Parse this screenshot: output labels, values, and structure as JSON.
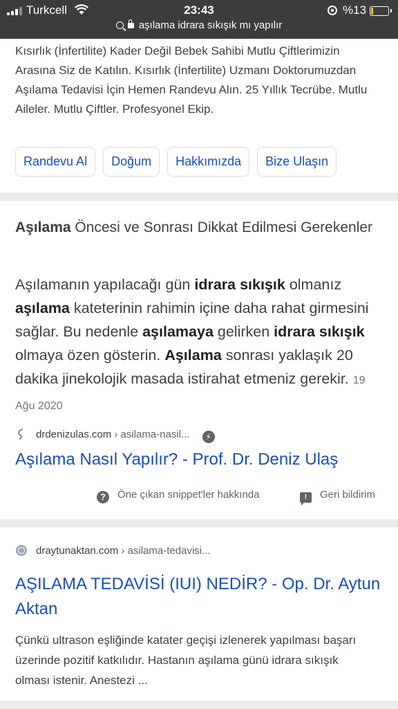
{
  "status_bar": {
    "carrier": "Turkcell",
    "time": "23:43",
    "battery_percent": "%13",
    "battery_level": 0.13,
    "url": "aşılama idrara sıkışık mı yapılır",
    "icons": [
      "signal-icon",
      "wifi-icon",
      "rotation-lock-icon",
      "battery-icon",
      "search-icon",
      "lock-icon"
    ]
  },
  "ad": {
    "text": "Kısırlık (İnfertilite) Kader Değil Bebek Sahibi Mutlu Çiftlerimizin Arasına Siz de Katılın. Kısırlık (İnfertilite) Uzmanı Doktorumuzdan Aşılama Tedavisi İçin Hemen Randevu Alın. 25 Yıllık Tecrübe. Mutlu Aileler. Mutlu Çiftler. Profesyonel Ekip.",
    "sitelinks": [
      "Randevu Al",
      "Doğum",
      "Hakkımızda",
      "Bize Ulaşın"
    ]
  },
  "featured_snippet": {
    "title_bold": "Aşılama",
    "title_rest": " Öncesi ve Sonrası Dikkat Edilmesi Gerekenler",
    "body_segments": [
      {
        "text": "Aşılamanın yapılacağı gün ",
        "bold": false
      },
      {
        "text": "idrara sıkışık",
        "bold": true
      },
      {
        "text": " olmanız ",
        "bold": false
      },
      {
        "text": "aşılama",
        "bold": true
      },
      {
        "text": " kateterinin rahimin içine daha rahat girmesini sağlar. Bu nedenle ",
        "bold": false
      },
      {
        "text": "aşılamaya",
        "bold": true
      },
      {
        "text": " gelirken ",
        "bold": false
      },
      {
        "text": "idrara sıkışık",
        "bold": true
      },
      {
        "text": " olmaya özen gösterin. ",
        "bold": false
      },
      {
        "text": "Aşılama",
        "bold": true
      },
      {
        "text": " sonrası yaklaşık 20 dakika jinekolojik masada istirahat etmeniz gerekir.",
        "bold": false
      }
    ],
    "date": "19 Ağu 2020",
    "source_domain": "drdenizulas.com",
    "source_path": " › asilama-nasil...",
    "link_title": "Aşılama Nasıl Yapılır? - Prof. Dr. Deniz Ulaş",
    "about_label": "Öne çıkan snippet'ler hakkında",
    "feedback_label": "Geri bildirim"
  },
  "result": {
    "source_domain": "draytunaktan.com",
    "source_path": " › asilama-tedavisi...",
    "title": "AŞILAMA TEDAVİSİ (IUI) NEDİR? - Op. Dr. Aytun Aktan",
    "snippet": "Çünkü ultrason eşliğinde katater geçişi izlenerek yapılması başarı üzerinde pozitif katkılıdır. Hastanın aşılama günü idrara sıkışık olması istenir. Anestezi ..."
  },
  "colors": {
    "link": "#1a4dbb",
    "status_bar_bg": "#3c3c3c",
    "battery": "#f6c700",
    "page_bg": "#ebebeb"
  }
}
